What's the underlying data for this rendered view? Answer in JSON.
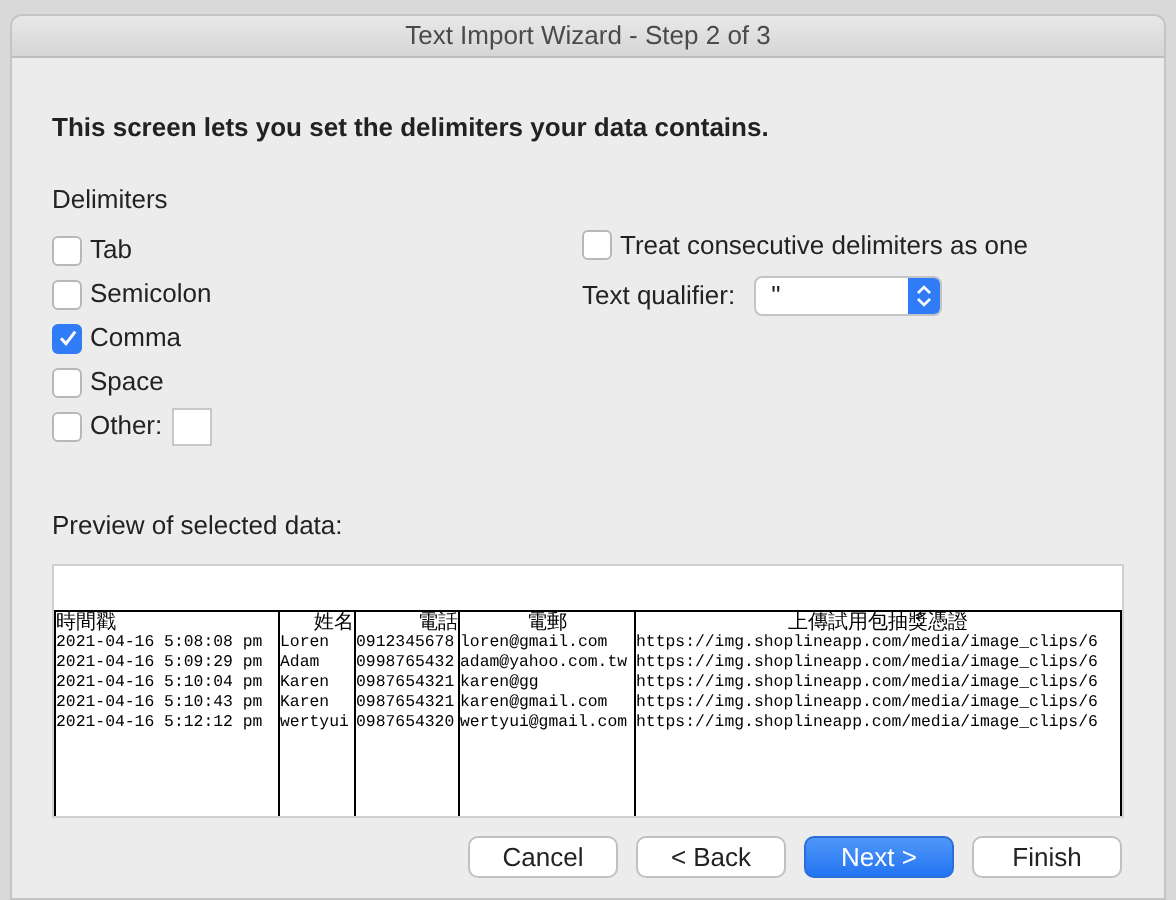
{
  "window": {
    "title": "Text Import Wizard - Step 2 of 3"
  },
  "heading": "This screen lets you set the delimiters your data contains.",
  "delimiters": {
    "label": "Delimiters",
    "items": [
      {
        "label": "Tab",
        "checked": false,
        "kind": "plain"
      },
      {
        "label": "Semicolon",
        "checked": false,
        "kind": "plain"
      },
      {
        "label": "Comma",
        "checked": true,
        "kind": "plain"
      },
      {
        "label": "Space",
        "checked": false,
        "kind": "plain"
      },
      {
        "label": "Other:",
        "checked": false,
        "kind": "other"
      }
    ]
  },
  "consecutive": {
    "label": "Treat consecutive delimiters as one",
    "checked": false
  },
  "text_qualifier": {
    "label": "Text qualifier:",
    "value": "\""
  },
  "preview": {
    "label": "Preview of selected data:",
    "columns": [
      "時間戳",
      "姓名",
      "電話",
      "電郵",
      "上傳試用包抽獎憑證"
    ],
    "rows": [
      [
        "2021-04-16  5:08:08 pm",
        "Loren",
        "0912345678",
        "loren@gmail.com",
        "https://img.shoplineapp.com/media/image_clips/6"
      ],
      [
        "2021-04-16  5:09:29 pm",
        "Adam",
        "0998765432",
        "adam@yahoo.com.tw",
        "https://img.shoplineapp.com/media/image_clips/6"
      ],
      [
        "2021-04-16  5:10:04 pm",
        "Karen",
        "0987654321",
        "karen@gg",
        "https://img.shoplineapp.com/media/image_clips/6"
      ],
      [
        "2021-04-16  5:10:43 pm",
        "Karen",
        "0987654321",
        "karen@gmail.com",
        "https://img.shoplineapp.com/media/image_clips/6"
      ],
      [
        "2021-04-16  5:12:12 pm",
        "wertyui",
        "0987654320",
        "wertyui@gmail.com",
        "https://img.shoplineapp.com/media/image_clips/6"
      ]
    ]
  },
  "buttons": [
    {
      "label": "Cancel",
      "kind": "normal"
    },
    {
      "label": "< Back",
      "kind": "normal"
    },
    {
      "label": "Next >",
      "kind": "default"
    },
    {
      "label": "Finish",
      "kind": "normal"
    }
  ]
}
